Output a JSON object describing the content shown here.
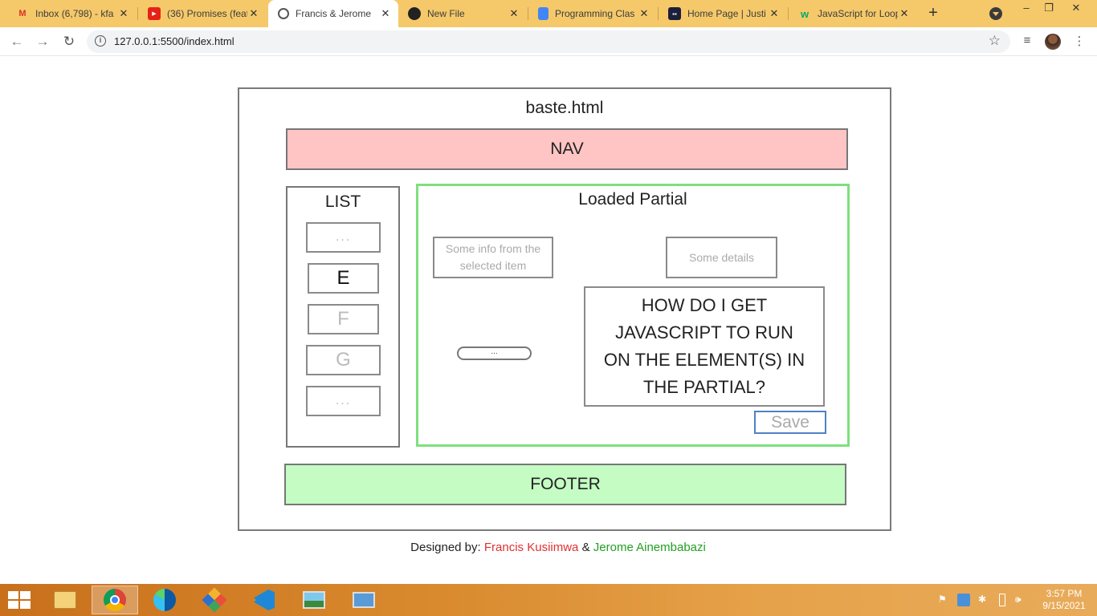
{
  "browser": {
    "tabs": [
      {
        "title": "Inbox (6,798) - kfa",
        "icon": "gmail-icon"
      },
      {
        "title": "(36) Promises (feat",
        "icon": "youtube-icon"
      },
      {
        "title": "Francis & Jerome",
        "icon": "globe-icon"
      },
      {
        "title": "New File",
        "icon": "github-icon"
      },
      {
        "title": "Programming Clas",
        "icon": "docs-icon"
      },
      {
        "title": "Home Page | Justi",
        "icon": "site-icon"
      },
      {
        "title": "JavaScript for Loop",
        "icon": "w3schools-icon"
      }
    ],
    "url": "127.0.0.1:5500/index.html"
  },
  "page": {
    "title": "baste.html",
    "nav": "NAV",
    "list": {
      "title": "LIST",
      "items": [
        "...",
        "E",
        "F",
        "G",
        "..."
      ]
    },
    "partial": {
      "title": "Loaded Partial",
      "info_text": "Some info from the selected item",
      "details_text": "Some details",
      "pill_text": "...",
      "question": "HOW DO I GET JAVASCRIPT TO RUN ON THE ELEMENT(S) IN THE PARTIAL?",
      "save_label": "Save"
    },
    "footer": "FOOTER",
    "credit": {
      "prefix": "Designed by:",
      "name1": "Francis Kusiimwa",
      "joiner": "&",
      "name2": "Jerome Ainembabazi"
    }
  },
  "taskbar": {
    "time": "3:57 PM",
    "date": "9/15/2021"
  }
}
